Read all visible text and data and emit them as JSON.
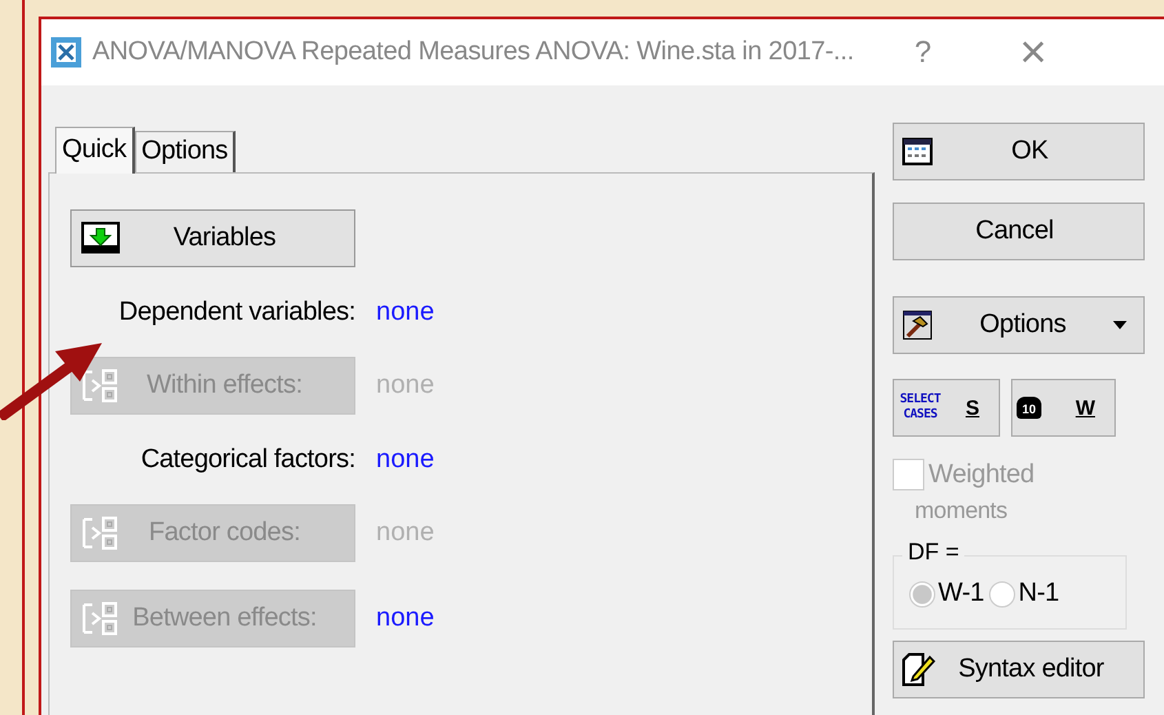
{
  "window": {
    "title": "ANOVA/MANOVA Repeated Measures ANOVA: Wine.sta in 2017-...",
    "help": "?",
    "close": "×"
  },
  "tabs": [
    {
      "label": "Quick",
      "selected": true
    },
    {
      "label": "Options",
      "selected": false
    }
  ],
  "quick": [
    {
      "kind": "button",
      "label": "Variables",
      "disabled": false
    },
    {
      "kind": "field",
      "label": "Dependent variables:",
      "value": "none",
      "disabled": false
    },
    {
      "kind": "button",
      "label": "Within effects:",
      "value": "none",
      "disabled": true
    },
    {
      "kind": "field",
      "label": "Categorical factors:",
      "value": "none",
      "disabled": false
    },
    {
      "kind": "button",
      "label": "Factor codes:",
      "value": "none",
      "disabled": true
    },
    {
      "kind": "button",
      "label": "Between effects:",
      "value": "none",
      "disabled": true,
      "value_disabled": false
    }
  ],
  "buttons": [
    {
      "label": "OK"
    },
    {
      "label": "Cancel"
    },
    {
      "label": "Options"
    }
  ],
  "small_buttons": [
    {
      "icon_text": "SELECT CASES",
      "label": "S"
    },
    {
      "icon_text": "10",
      "label": "W"
    }
  ],
  "weighted_moments": {
    "label": "Weighted",
    "label_line2": "moments",
    "checked": false,
    "disabled": true
  },
  "df_group": {
    "title": "DF =",
    "options": [
      {
        "label": "W-1",
        "selected": true
      },
      {
        "label": "N-1",
        "selected": false
      }
    ],
    "disabled": true
  },
  "syntax_button": {
    "label": "Syntax editor"
  }
}
